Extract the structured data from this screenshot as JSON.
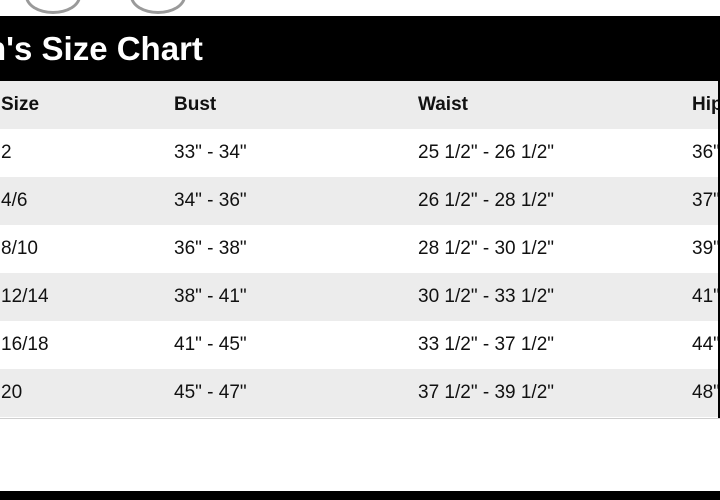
{
  "chart": {
    "title": "n's Size Chart",
    "columns": [
      "Size",
      "Bust",
      "Waist",
      "Hip"
    ],
    "rows": [
      [
        "2",
        "33\" - 34\"",
        "25 1/2\" - 26 1/2\"",
        "36\""
      ],
      [
        "4/6",
        "34\" - 36\"",
        "26 1/2\" - 28 1/2\"",
        "37\""
      ],
      [
        "8/10",
        "36\" - 38\"",
        "28 1/2\" - 30 1/2\"",
        "39\""
      ],
      [
        "12/14",
        "38\" - 41\"",
        "30 1/2\" - 33 1/2\"",
        "41\""
      ],
      [
        "16/18",
        "41\" - 45\"",
        "33 1/2\" - 37 1/2\"",
        "44\""
      ],
      [
        "20",
        "45\" - 47\"",
        "37 1/2\" - 39 1/2\"",
        "48\""
      ]
    ]
  }
}
